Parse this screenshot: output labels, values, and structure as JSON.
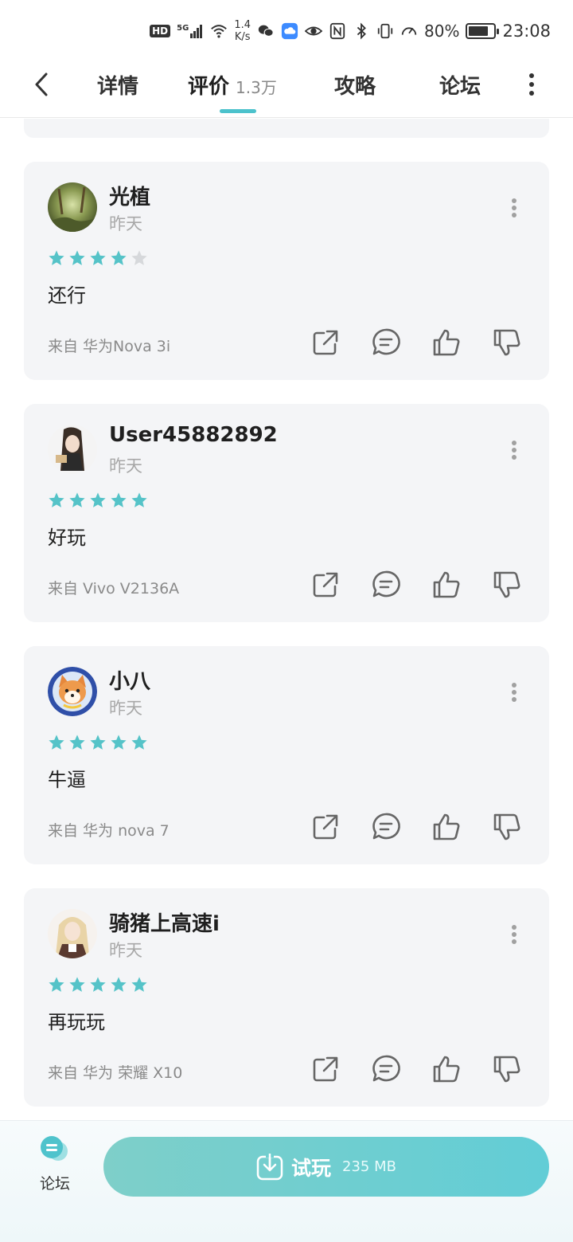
{
  "status_bar": {
    "hd": "HD",
    "network": "5G",
    "speed_value": "1.4",
    "speed_unit": "K/s",
    "battery": "80%",
    "battery_level": 0.8,
    "time": "23:08"
  },
  "nav": {
    "tabs": [
      {
        "label": "详情"
      },
      {
        "label": "评价",
        "count": "1.3万",
        "active": true
      },
      {
        "label": "攻略"
      },
      {
        "label": "论坛"
      }
    ]
  },
  "reviews": [
    {
      "user": "光植",
      "time": "昨天",
      "rating": 4,
      "content": "还行",
      "device": "来自 华为Nova 3i",
      "avatar": "forest-avatar"
    },
    {
      "user": "User45882892",
      "time": "昨天",
      "rating": 5,
      "content": "好玩",
      "device": "来自 Vivo V2136A",
      "avatar": "anime-girl-avatar"
    },
    {
      "user": "小八",
      "time": "昨天",
      "rating": 5,
      "content": "牛逼",
      "device": "来自 华为 nova 7",
      "avatar": "shiba-dog-avatar"
    },
    {
      "user": "骑猪上高速i",
      "time": "昨天",
      "rating": 5,
      "content": "再玩玩",
      "device": "来自 华为 荣耀 X10",
      "avatar": "blonde-girl-avatar"
    }
  ],
  "bottom": {
    "forum_label": "论坛",
    "trial_label": "试玩",
    "trial_size": "235 MB"
  },
  "colors": {
    "accent": "#4cc2cc",
    "star_on": "#55c3c8",
    "star_off": "#d6d8db",
    "card_bg": "#f4f5f7"
  }
}
